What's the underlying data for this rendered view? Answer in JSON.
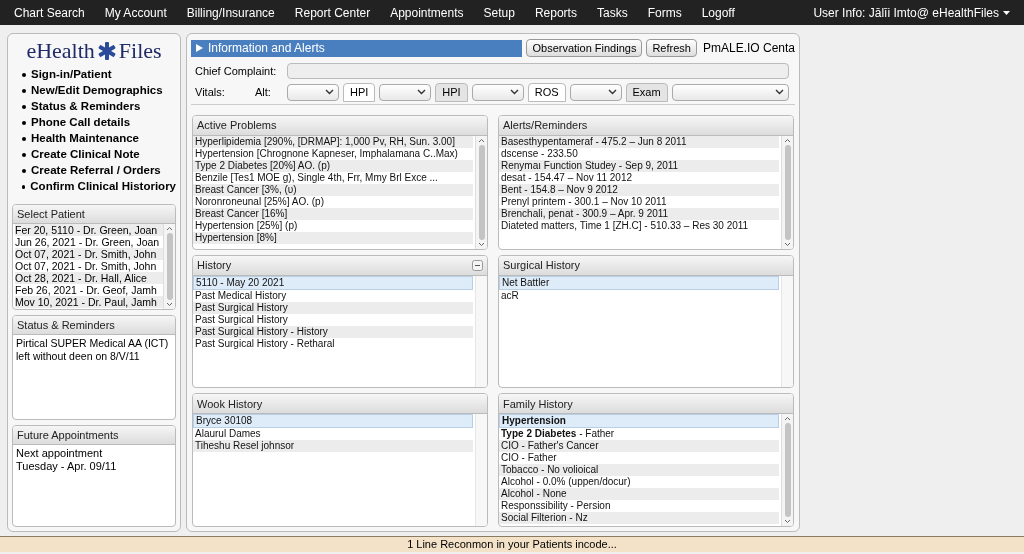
{
  "nav": {
    "items": [
      "Chart Search",
      "My Account",
      "Billing/Insurance",
      "Report Center",
      "Appointments",
      "Setup",
      "Reports",
      "Tasks",
      "Forms",
      "Logoff"
    ],
    "user": "User Info: Jālīi Imto@ eHealthFiles"
  },
  "sidebar": {
    "logo_left": "eHealth",
    "logo_right": "Files",
    "links": [
      "Sign-in/Patient",
      "New/Edit Demographics",
      "Status & Reminders",
      "Phone Call details",
      "Health Maintenance",
      "Create Clinical Note",
      "Create Referral / Orders",
      "Confirm Clinical Historiory"
    ],
    "select_patient": {
      "title": "Select Patient",
      "rows": [
        "Fer 20, 5110 - Dr. Green, Joan",
        "Jun 26, 2021 - Dr. Green, Joan",
        "Oct 07, 2021 - Dr. Smith, John",
        "Oct 07, 2021 - Dr. Smith, John",
        "Oct 28, 2021 - Dr. Hall, Alice",
        "Feb 26, 2021 - Dr. Geof, Jamh",
        "Mov 10, 2021 - Dr. Paul, Jamh"
      ]
    },
    "status": {
      "title": "Status & Reminders",
      "text": "Pirtical SUPER Medical AA (ICT) left without deen on 8/V/11"
    },
    "future": {
      "title": "Future Appointments",
      "lines": [
        "Next appointment",
        "Tuesday - Apr. 09/11"
      ]
    }
  },
  "main": {
    "title": "Information and Alerts",
    "buttons": [
      "Observation Findings",
      "Refresh"
    ],
    "org": "PmALE.IO Centa",
    "chief_complaint": {
      "label": "Chief Complaint:"
    },
    "vitals": {
      "label": "Vitals:",
      "alt_label": "Alt:",
      "items": [
        {
          "kind": "select"
        },
        {
          "kind": "tab",
          "label": "HPI",
          "selected": true
        },
        {
          "kind": "select"
        },
        {
          "kind": "tab",
          "label": "HPI",
          "selected": false
        },
        {
          "kind": "select"
        },
        {
          "kind": "tab",
          "label": "ROS",
          "selected": true
        },
        {
          "kind": "select"
        },
        {
          "kind": "tab",
          "label": "Exam",
          "selected": false
        },
        {
          "kind": "wide-select"
        }
      ]
    },
    "panels": [
      {
        "title": "Active Problems",
        "scroll": true,
        "collapse": false,
        "rows": [
          {
            "text": "Hyperlipidemia [290%, [DRMAP]: 1,000 Pv, RH, Sun. 3.00]",
            "selected": false
          },
          {
            "text": "Hypertension [Chrognone Kapneser, Imphalamana C..Max)",
            "selected": false
          },
          {
            "text": "Type 2 Diabetes [20%] AO. (p)",
            "selected": false
          },
          {
            "text": "Benzile [Tes1 MOE g), Single 4th, Frr, Mmy Brl Exce ...",
            "selected": false
          },
          {
            "text": "Breast Cancer [3%, (υ)",
            "selected": false
          },
          {
            "text": "Noronroneunal [25%] AO. (p)",
            "selected": false
          },
          {
            "text": "Breast Cancer [16%]",
            "selected": false
          },
          {
            "text": "Hypertension [25%] (p)",
            "selected": false
          },
          {
            "text": "Hypertension [8%]",
            "selected": false
          }
        ]
      },
      {
        "title": "Alerts/Reminders",
        "scroll": true,
        "collapse": false,
        "rows": [
          {
            "text": "Basesthypentameraf - 475.2 – Jun 8 2011",
            "selected": false
          },
          {
            "text": "dscense - 233.50",
            "selected": false
          },
          {
            "text": "Renymaı Function Studey - Sep 9, 2011",
            "selected": false
          },
          {
            "text": "desat - 154.47 – Nov 11 2012",
            "selected": false
          },
          {
            "text": "Bent - 154.8 – Nov 9 2012",
            "selected": false
          },
          {
            "text": "Prenyl printem - 300.1 – Nov 10 2011",
            "selected": false
          },
          {
            "text": "Brenchali, penat - 300.9 – Apr. 9 2011",
            "selected": false
          },
          {
            "text": "Diateted matters, Time 1 [ZH.C] - 510.33 – Res 30 2011",
            "selected": false
          }
        ]
      },
      {
        "title": "History",
        "scroll": false,
        "collapse": true,
        "rows": [
          {
            "text": "5110 - May 20 2021",
            "selected": true
          },
          {
            "text": "Past Medical History",
            "selected": false
          },
          {
            "text": "Past Surgical History",
            "selected": false
          },
          {
            "text": "Past Surgical History",
            "selected": false
          },
          {
            "text": "Past Surgical History - History",
            "selected": false
          },
          {
            "text": "Past Surgical History - Retharal",
            "selected": false
          }
        ]
      },
      {
        "title": "Surgical History",
        "scroll": false,
        "collapse": false,
        "rows": [
          {
            "text": "Net Battler",
            "selected": true
          },
          {
            "text": "acR",
            "selected": false
          }
        ]
      },
      {
        "title": "Wook History",
        "scroll": false,
        "collapse": false,
        "rows": [
          {
            "text": "Bryce 30108",
            "selected": true
          },
          {
            "text": "Alaurul Dames",
            "selected": false
          },
          {
            "text": "Tiheshu Resel johnsor",
            "selected": false
          }
        ]
      },
      {
        "title": "Family History",
        "scroll": true,
        "collapse": false,
        "rows": [
          {
            "text": "**Hypertension**",
            "selected": true
          },
          {
            "text": "**Type 2 Diabetes** - Father",
            "selected": false
          },
          {
            "text": "CIO - Father's Cancer",
            "selected": false
          },
          {
            "text": "CIO - Father",
            "selected": false
          },
          {
            "text": "Tobacco - No volioical",
            "selected": false
          },
          {
            "text": "Alcohol - 0.0% (uppen/docur)",
            "selected": false
          },
          {
            "text": "Alcohol - None",
            "selected": false
          },
          {
            "text": "Responssibility - Persion",
            "selected": false
          },
          {
            "text": "Social Filterion - Nz",
            "selected": false
          }
        ]
      }
    ]
  },
  "status_bar": "1 Line Reconmon in your Patients incode..."
}
